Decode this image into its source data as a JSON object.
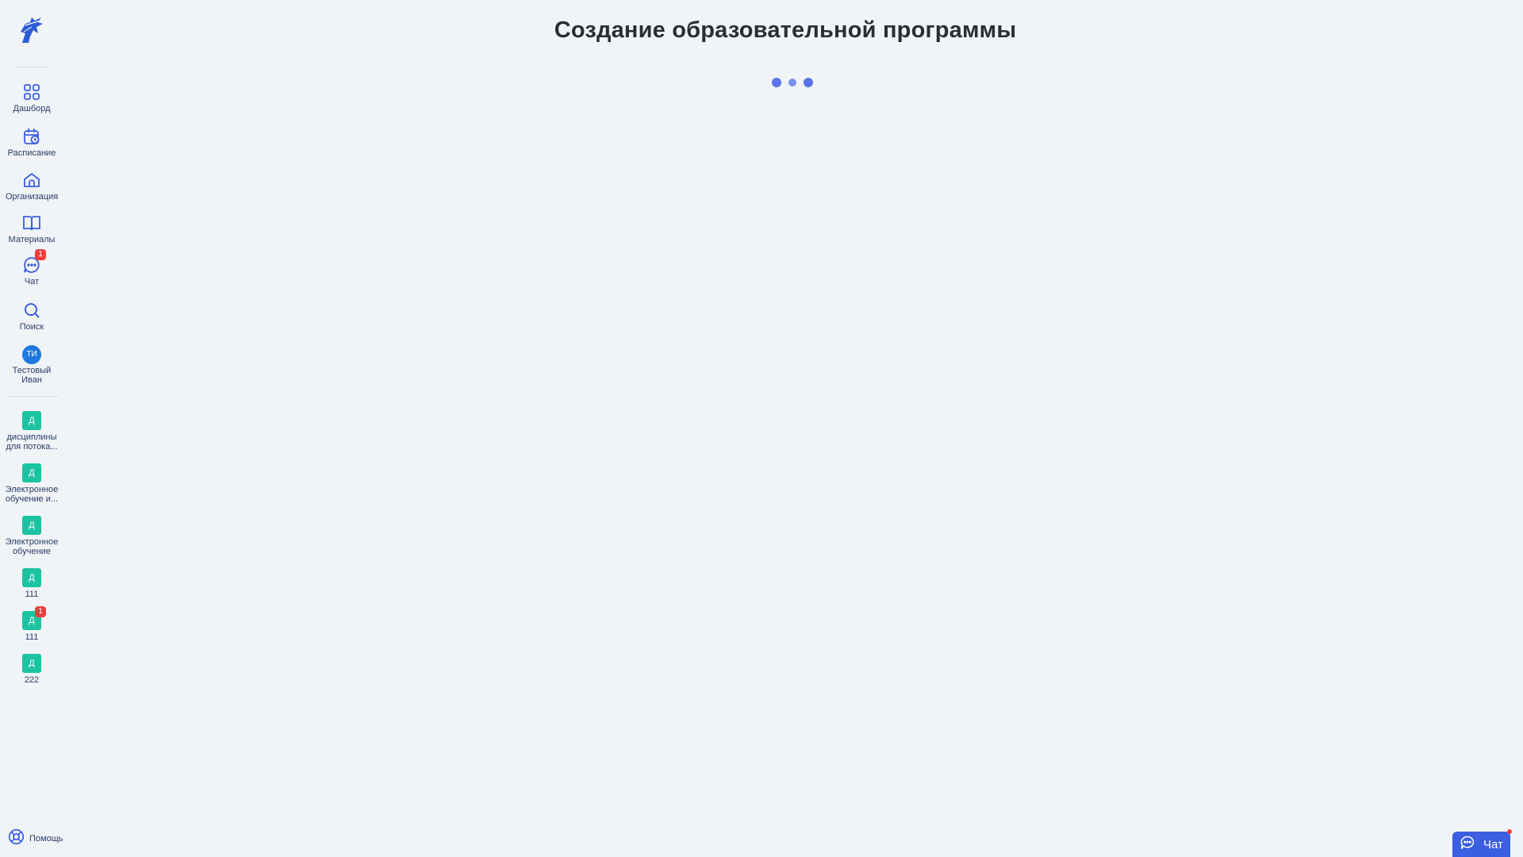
{
  "page": {
    "title": "Создание образовательной программы"
  },
  "sidebar": {
    "logo_icon": "knight-logo-icon",
    "nav": [
      {
        "label": "Дашборд",
        "icon": "grid-icon"
      },
      {
        "label": "Расписание",
        "icon": "calendar-icon"
      },
      {
        "label": "Организация",
        "icon": "home-icon"
      },
      {
        "label": "Материалы",
        "icon": "book-icon"
      },
      {
        "label": "Чат",
        "icon": "chat-icon",
        "badge": "1"
      },
      {
        "label": "Поиск",
        "icon": "search-icon"
      }
    ],
    "user": {
      "initials": "ТИ",
      "name_line1": "Тестовый",
      "name_line2": "Иван"
    },
    "courses": [
      {
        "tile": "Д",
        "line1": "дисциплины",
        "line2": "для потока..."
      },
      {
        "tile": "Д",
        "line1": "Электронное",
        "line2": "обучение и..."
      },
      {
        "tile": "Д",
        "line1": "Электронное",
        "line2": "обучение"
      },
      {
        "tile": "Д",
        "line1": "111"
      },
      {
        "tile": "Д",
        "line1": "111",
        "badge": "1"
      },
      {
        "tile": "Д",
        "line1": "222"
      }
    ],
    "help_label": "Помощь"
  },
  "chat_widget": {
    "label": "Чат"
  },
  "colors": {
    "background": "#f0f4f7",
    "accent": "#3b5fe0",
    "course_tile": "#1cc3a0",
    "badge": "#ef3d3d",
    "avatar": "#1e7ae0"
  }
}
